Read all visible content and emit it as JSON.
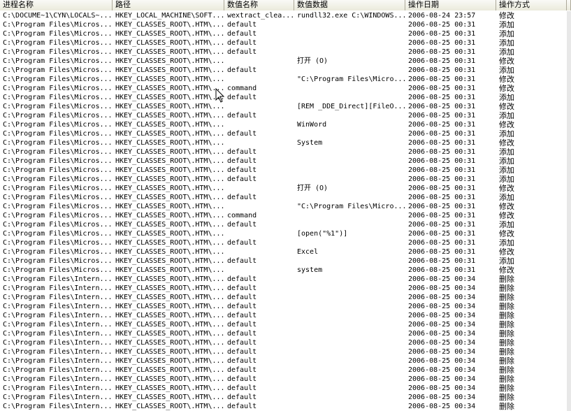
{
  "columns": [
    "进程名称",
    "路径",
    "数值名称",
    "数值数据",
    "操作日期",
    "操作方式",
    ""
  ],
  "rows": [
    [
      "C:\\DOCUME~1\\CYN\\LOCALS~...",
      "HKEY_LOCAL_MACHINE\\SOFT...",
      "wextract_clea...",
      "rundll32.exe C:\\WINDOWS...",
      "2006-08-24 23:57",
      "修改"
    ],
    [
      "C:\\Program Files\\Micros...",
      "HKEY_CLASSES_ROOT\\.HTM\\...",
      "default",
      "",
      "2006-08-25 00:31",
      "添加"
    ],
    [
      "C:\\Program Files\\Micros...",
      "HKEY_CLASSES_ROOT\\.HTM\\...",
      "default",
      "",
      "2006-08-25 00:31",
      "添加"
    ],
    [
      "C:\\Program Files\\Micros...",
      "HKEY_CLASSES_ROOT\\.HTM\\...",
      "default",
      "",
      "2006-08-25 00:31",
      "添加"
    ],
    [
      "C:\\Program Files\\Micros...",
      "HKEY_CLASSES_ROOT\\.HTM\\...",
      "default",
      "",
      "2006-08-25 00:31",
      "添加"
    ],
    [
      "C:\\Program Files\\Micros...",
      "HKEY_CLASSES_ROOT\\.HTM\\...",
      "",
      "打开 (O)",
      "2006-08-25 00:31",
      "修改"
    ],
    [
      "C:\\Program Files\\Micros...",
      "HKEY_CLASSES_ROOT\\.HTM\\...",
      "default",
      "",
      "2006-08-25 00:31",
      "添加"
    ],
    [
      "C:\\Program Files\\Micros...",
      "HKEY_CLASSES_ROOT\\.HTM\\...",
      "",
      "\"C:\\Program Files\\Micro...",
      "2006-08-25 00:31",
      "修改"
    ],
    [
      "C:\\Program Files\\Micros...",
      "HKEY_CLASSES_ROOT\\.HTM\\...",
      "command",
      "",
      "2006-08-25 00:31",
      "修改"
    ],
    [
      "C:\\Program Files\\Micros...",
      "HKEY_CLASSES_ROOT\\.HTM\\...",
      "default",
      "",
      "2006-08-25 00:31",
      "添加"
    ],
    [
      "C:\\Program Files\\Micros...",
      "HKEY_CLASSES_ROOT\\.HTM\\...",
      "",
      "[REM _DDE_Direct][FileO...",
      "2006-08-25 00:31",
      "修改"
    ],
    [
      "C:\\Program Files\\Micros...",
      "HKEY_CLASSES_ROOT\\.HTM\\...",
      "default",
      "",
      "2006-08-25 00:31",
      "添加"
    ],
    [
      "C:\\Program Files\\Micros...",
      "HKEY_CLASSES_ROOT\\.HTM\\...",
      "",
      "WinWord",
      "2006-08-25 00:31",
      "修改"
    ],
    [
      "C:\\Program Files\\Micros...",
      "HKEY_CLASSES_ROOT\\.HTM\\...",
      "default",
      "",
      "2006-08-25 00:31",
      "添加"
    ],
    [
      "C:\\Program Files\\Micros...",
      "HKEY_CLASSES_ROOT\\.HTM\\...",
      "",
      "System",
      "2006-08-25 00:31",
      "修改"
    ],
    [
      "C:\\Program Files\\Micros...",
      "HKEY_CLASSES_ROOT\\.HTM\\...",
      "default",
      "",
      "2006-08-25 00:31",
      "添加"
    ],
    [
      "C:\\Program Files\\Micros...",
      "HKEY_CLASSES_ROOT\\.HTM\\...",
      "default",
      "",
      "2006-08-25 00:31",
      "添加"
    ],
    [
      "C:\\Program Files\\Micros...",
      "HKEY_CLASSES_ROOT\\.HTM\\...",
      "default",
      "",
      "2006-08-25 00:31",
      "添加"
    ],
    [
      "C:\\Program Files\\Micros...",
      "HKEY_CLASSES_ROOT\\.HTM\\...",
      "default",
      "",
      "2006-08-25 00:31",
      "添加"
    ],
    [
      "C:\\Program Files\\Micros...",
      "HKEY_CLASSES_ROOT\\.HTM\\...",
      "",
      "打开 (O)",
      "2006-08-25 00:31",
      "修改"
    ],
    [
      "C:\\Program Files\\Micros...",
      "HKEY_CLASSES_ROOT\\.HTM\\...",
      "default",
      "",
      "2006-08-25 00:31",
      "添加"
    ],
    [
      "C:\\Program Files\\Micros...",
      "HKEY_CLASSES_ROOT\\.HTM\\...",
      "",
      "\"C:\\Program Files\\Micro...",
      "2006-08-25 00:31",
      "修改"
    ],
    [
      "C:\\Program Files\\Micros...",
      "HKEY_CLASSES_ROOT\\.HTM\\...",
      "command",
      "",
      "2006-08-25 00:31",
      "修改"
    ],
    [
      "C:\\Program Files\\Micros...",
      "HKEY_CLASSES_ROOT\\.HTM\\...",
      "default",
      "",
      "2006-08-25 00:31",
      "添加"
    ],
    [
      "C:\\Program Files\\Micros...",
      "HKEY_CLASSES_ROOT\\.HTM\\...",
      "",
      "[open(\"%1\")]",
      "2006-08-25 00:31",
      "修改"
    ],
    [
      "C:\\Program Files\\Micros...",
      "HKEY_CLASSES_ROOT\\.HTM\\...",
      "default",
      "",
      "2006-08-25 00:31",
      "添加"
    ],
    [
      "C:\\Program Files\\Micros...",
      "HKEY_CLASSES_ROOT\\.HTM\\...",
      "",
      "Excel",
      "2006-08-25 00:31",
      "修改"
    ],
    [
      "C:\\Program Files\\Micros...",
      "HKEY_CLASSES_ROOT\\.HTM\\...",
      "default",
      "",
      "2006-08-25 00:31",
      "添加"
    ],
    [
      "C:\\Program Files\\Micros...",
      "HKEY_CLASSES_ROOT\\.HTM\\...",
      "",
      "system",
      "2006-08-25 00:31",
      "修改"
    ],
    [
      "C:\\Program Files\\Intern...",
      "HKEY_CLASSES_ROOT\\.HTM\\...",
      "default",
      "",
      "2006-08-25 00:34",
      "删除"
    ],
    [
      "C:\\Program Files\\Intern...",
      "HKEY_CLASSES_ROOT\\.HTM\\...",
      "default",
      "",
      "2006-08-25 00:34",
      "删除"
    ],
    [
      "C:\\Program Files\\Intern...",
      "HKEY_CLASSES_ROOT\\.HTM\\...",
      "default",
      "",
      "2006-08-25 00:34",
      "删除"
    ],
    [
      "C:\\Program Files\\Intern...",
      "HKEY_CLASSES_ROOT\\.HTM\\...",
      "default",
      "",
      "2006-08-25 00:34",
      "删除"
    ],
    [
      "C:\\Program Files\\Intern...",
      "HKEY_CLASSES_ROOT\\.HTM\\...",
      "default",
      "",
      "2006-08-25 00:34",
      "删除"
    ],
    [
      "C:\\Program Files\\Intern...",
      "HKEY_CLASSES_ROOT\\.HTM\\...",
      "default",
      "",
      "2006-08-25 00:34",
      "删除"
    ],
    [
      "C:\\Program Files\\Intern...",
      "HKEY_CLASSES_ROOT\\.HTM\\...",
      "default",
      "",
      "2006-08-25 00:34",
      "删除"
    ],
    [
      "C:\\Program Files\\Intern...",
      "HKEY_CLASSES_ROOT\\.HTM\\...",
      "default",
      "",
      "2006-08-25 00:34",
      "删除"
    ],
    [
      "C:\\Program Files\\Intern...",
      "HKEY_CLASSES_ROOT\\.HTM\\...",
      "default",
      "",
      "2006-08-25 00:34",
      "删除"
    ],
    [
      "C:\\Program Files\\Intern...",
      "HKEY_CLASSES_ROOT\\.HTM\\...",
      "default",
      "",
      "2006-08-25 00:34",
      "删除"
    ],
    [
      "C:\\Program Files\\Intern...",
      "HKEY_CLASSES_ROOT\\.HTM\\...",
      "default",
      "",
      "2006-08-25 00:34",
      "删除"
    ],
    [
      "C:\\Program Files\\Intern...",
      "HKEY_CLASSES_ROOT\\.HTM\\...",
      "default",
      "",
      "2006-08-25 00:34",
      "删除"
    ],
    [
      "C:\\Program Files\\Intern...",
      "HKEY_CLASSES_ROOT\\.HTM\\...",
      "default",
      "",
      "2006-08-25 00:34",
      "删除"
    ],
    [
      "C:\\Program Files\\Intern...",
      "HKEY_CLASSES_ROOT\\.HTM\\...",
      "default",
      "",
      "2006-08-25 00:34",
      "删除"
    ],
    [
      "C:\\Program Files\\Intern...",
      "HKEY_CLASSES_ROOT\\.HTM\\...",
      "default",
      "",
      "2006-08-25 00:34",
      "删除"
    ]
  ]
}
